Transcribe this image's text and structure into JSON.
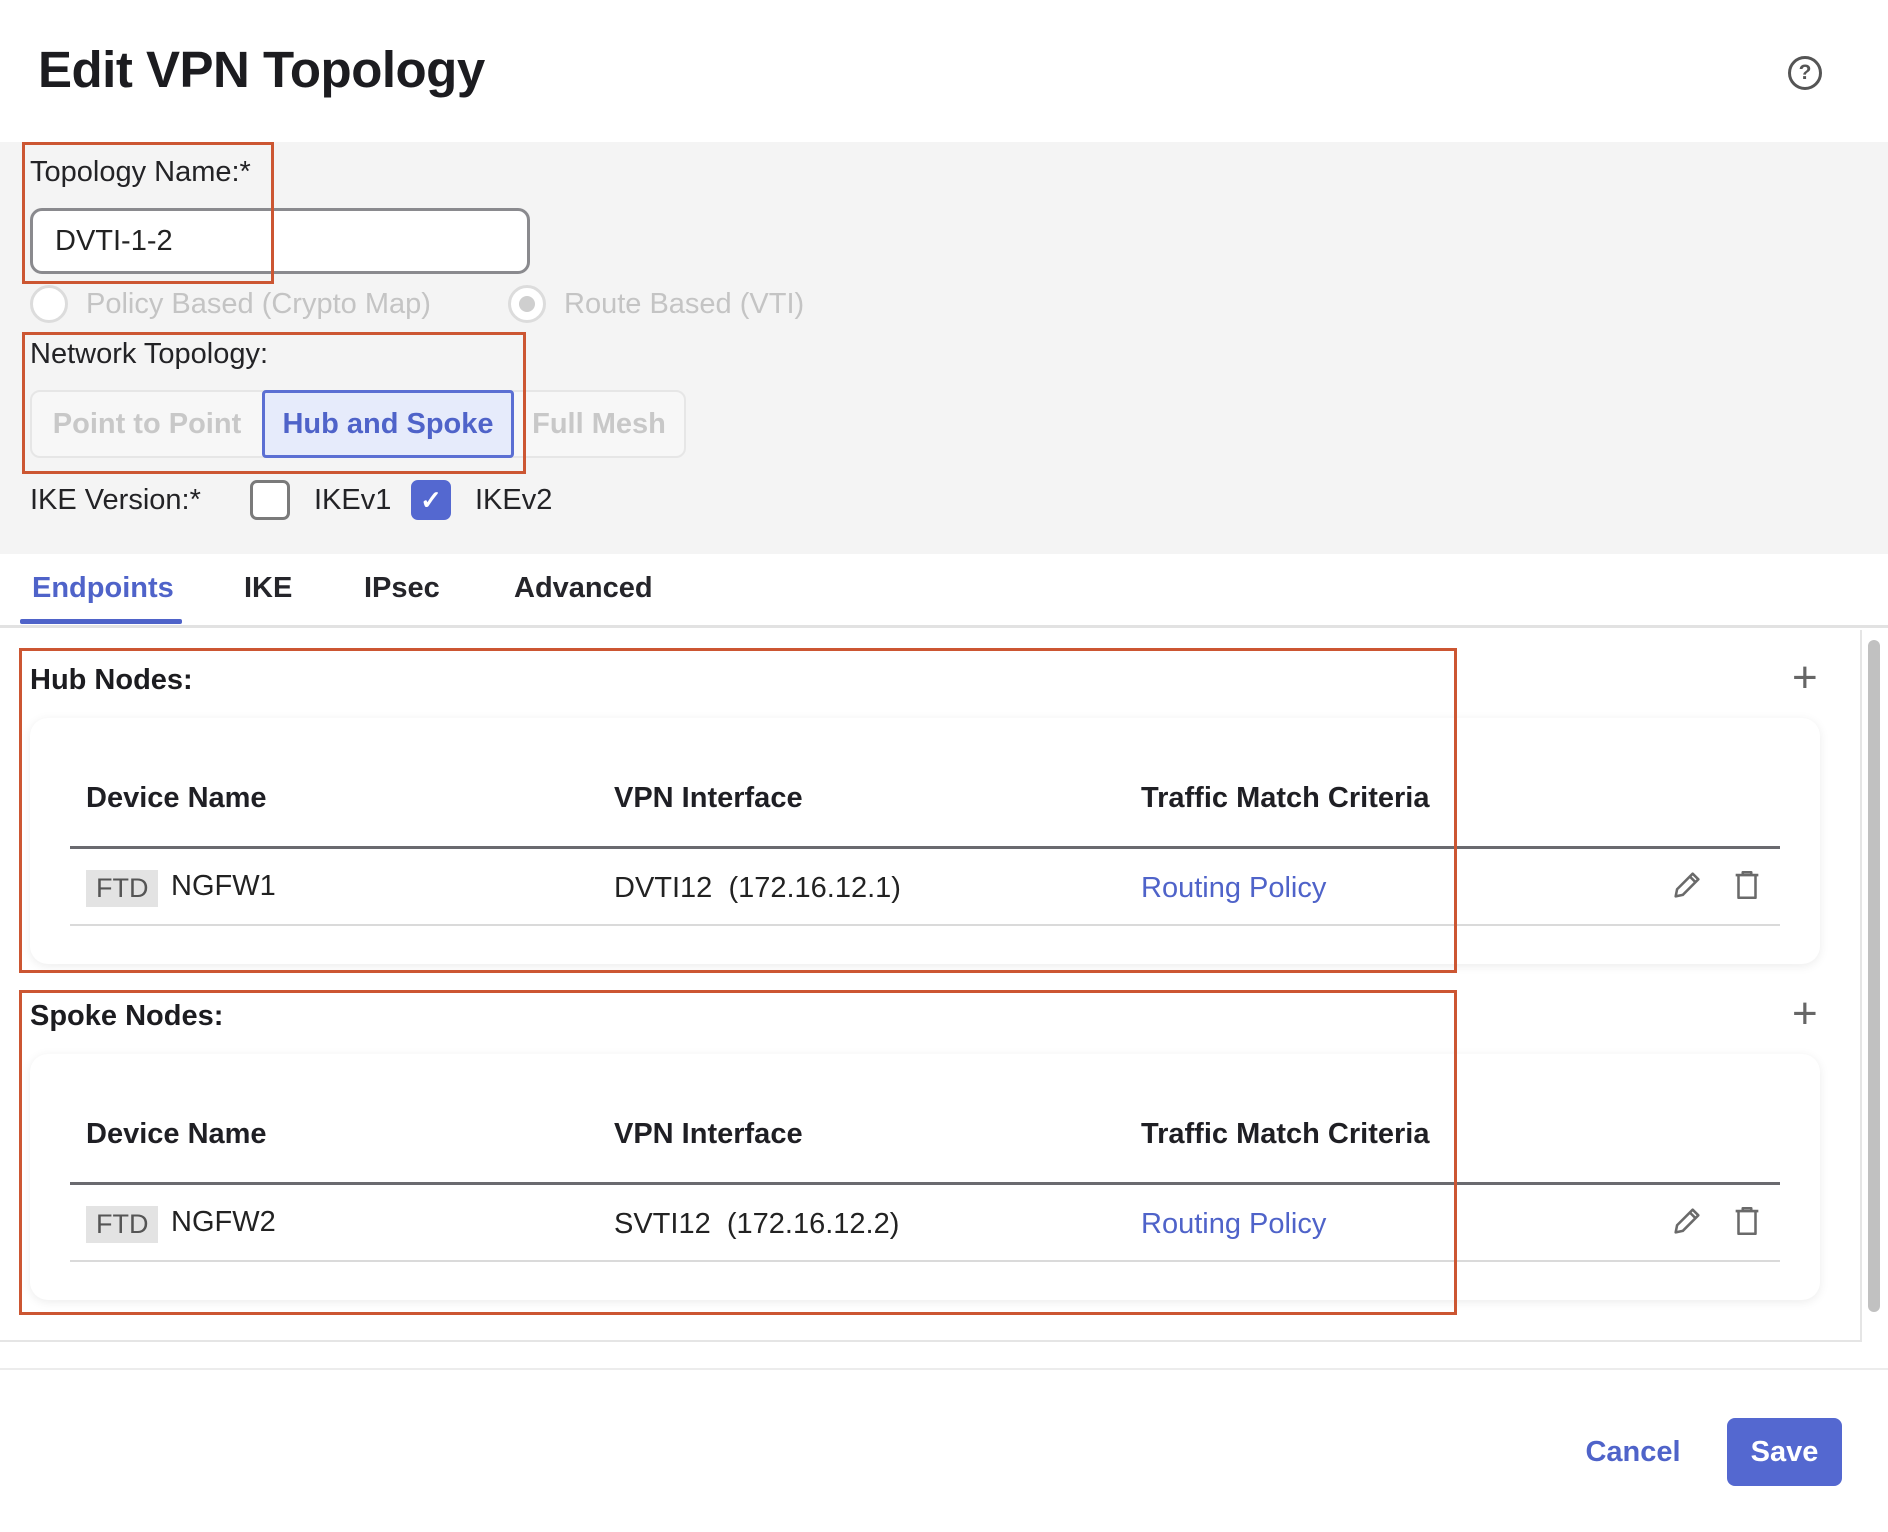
{
  "dialog": {
    "title": "Edit VPN Topology",
    "help_icon": "help-circle-icon"
  },
  "form": {
    "topology_name_label": "Topology Name:*",
    "topology_name_value": "DVTI-1-2",
    "vpn_type_options": [
      {
        "label": "Policy Based (Crypto Map)",
        "selected": false
      },
      {
        "label": "Route Based (VTI)",
        "selected": true
      }
    ],
    "network_topology_label": "Network Topology:",
    "network_topology_options": [
      {
        "label": "Point to Point",
        "selected": false
      },
      {
        "label": "Hub and Spoke",
        "selected": true
      },
      {
        "label": "Full Mesh",
        "selected": false
      }
    ],
    "ike_version_label": "IKE Version:*",
    "ike_versions": [
      {
        "label": "IKEv1",
        "checked": false
      },
      {
        "label": "IKEv2",
        "checked": true
      }
    ]
  },
  "tabs": [
    {
      "label": "Endpoints",
      "active": true
    },
    {
      "label": "IKE",
      "active": false
    },
    {
      "label": "IPsec",
      "active": false
    },
    {
      "label": "Advanced",
      "active": false
    }
  ],
  "hub_nodes": {
    "title": "Hub Nodes:",
    "columns": [
      "Device Name",
      "VPN Interface",
      "Traffic Match Criteria"
    ],
    "rows": [
      {
        "badge": "FTD",
        "device": "NGFW1",
        "interface": "DVTI12",
        "interface_ip": "(172.16.12.1)",
        "criteria": "Routing Policy"
      }
    ]
  },
  "spoke_nodes": {
    "title": "Spoke Nodes:",
    "columns": [
      "Device Name",
      "VPN Interface",
      "Traffic Match Criteria"
    ],
    "rows": [
      {
        "badge": "FTD",
        "device": "NGFW2",
        "interface": "SVTI12",
        "interface_ip": "(172.16.12.2)",
        "criteria": "Routing Policy"
      }
    ]
  },
  "footer": {
    "cancel_label": "Cancel",
    "save_label": "Save"
  },
  "colors": {
    "accent": "#4f63c9",
    "primary_button": "#5468d0",
    "annotation_box": "#cc5632",
    "panel_bg": "#f4f4f4"
  }
}
